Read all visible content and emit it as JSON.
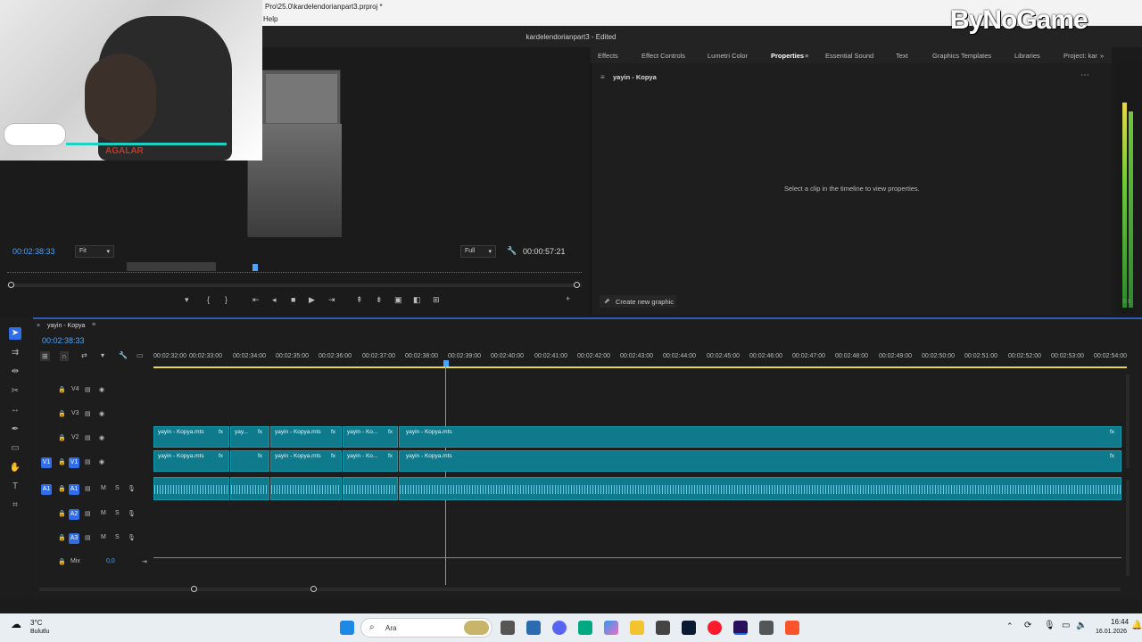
{
  "window": {
    "path": "Pro\\25.0\\kardelendorianpart3.prproj *",
    "menu_help": "Help",
    "document_title": "kardelendorianpart3 - Edited"
  },
  "overlay": {
    "brand": "ByNoGame",
    "streamer_tag": "AGALAR"
  },
  "program_monitor": {
    "timecode_current": "00:02:38:33",
    "fit_label": "Fit",
    "quality_label": "Full",
    "timecode_duration": "00:00:57:21"
  },
  "panel_tabs": [
    {
      "label": "Effects"
    },
    {
      "label": "Effect Controls"
    },
    {
      "label": "Lumetri Color"
    },
    {
      "label": "Properties"
    },
    {
      "label": "Essential Sound"
    },
    {
      "label": "Text"
    },
    {
      "label": "Graphics Templates"
    },
    {
      "label": "Libraries"
    },
    {
      "label": "Project: kar"
    }
  ],
  "properties": {
    "clip_name": "yayin - Kopya",
    "empty_message": "Select a clip in the timeline to view properties.",
    "create_graphic": "Create new graphic"
  },
  "meter": {
    "label": "S S"
  },
  "timeline": {
    "sequence_name": "yayin - Kopya",
    "timecode": "00:02:38:33",
    "ruler_ticks": [
      "00:02:32:00",
      "00:02:33:00",
      "00:02:34:00",
      "00:02:35:00",
      "00:02:36:00",
      "00:02:37:00",
      "00:02:38:00",
      "00:02:39:00",
      "00:02:40:00",
      "00:02:41:00",
      "00:02:42:00",
      "00:02:43:00",
      "00:02:44:00",
      "00:02:45:00",
      "00:02:46:00",
      "00:02:47:00",
      "00:02:48:00",
      "00:02:49:00",
      "00:02:50:00",
      "00:02:51:00",
      "00:02:52:00",
      "00:02:53:00",
      "00:02:54:00"
    ],
    "tracks": {
      "v4": "V4",
      "v3": "V3",
      "v2": "V2",
      "v1": "V1",
      "v1_src": "V1",
      "a1": "A1",
      "a1_src": "A1",
      "a2": "A2",
      "a3": "A3",
      "mix": "Mix",
      "mix_value": "0,0"
    },
    "clips": {
      "c1": "yayin - Kopya.mts",
      "c2": "yay...",
      "c3": "yayin - Kopya.mts",
      "c4": "yayin - Ko...",
      "c5": "yayin - Kopya.mts",
      "fx": "fx"
    }
  },
  "taskbar": {
    "weather_temp": "3°C",
    "weather_desc": "Bulutlu",
    "search_placeholder": "Ara",
    "time": "16:44",
    "date": "16.01.2026"
  }
}
